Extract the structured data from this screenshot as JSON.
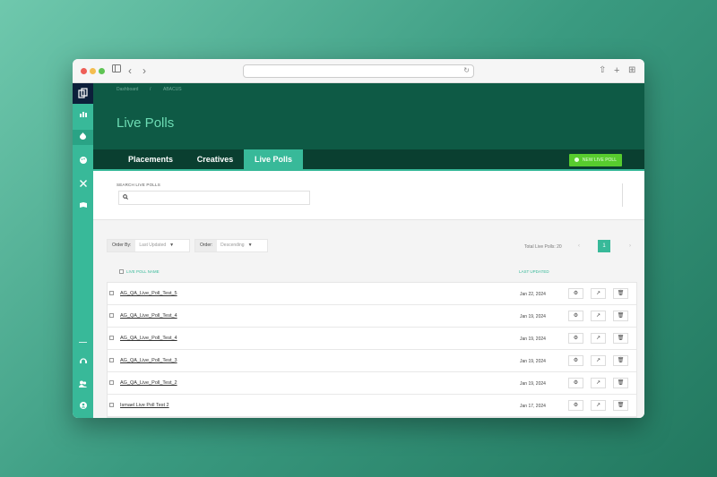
{
  "browser": {
    "back": "‹",
    "forward": "›",
    "sidebar_icon": "sidebar-icon",
    "reload": "↻",
    "share": "⇧",
    "newtab": "+",
    "tabs": "⊞"
  },
  "app": {
    "logo": "▢"
  },
  "sidebar": {
    "items": [
      "dashboard-icon",
      "flame-icon",
      "palette-icon",
      "tools-icon",
      "flag-icon"
    ],
    "bottom": [
      "support-icon",
      "users-icon",
      "account-icon"
    ]
  },
  "breadcrumb": {
    "first": "Dashboard",
    "separator": "/",
    "second": "ABACUS"
  },
  "page": {
    "title": "Live Polls"
  },
  "tabs": [
    {
      "label": "Placements"
    },
    {
      "label": "Creatives"
    },
    {
      "label": "Live Polls"
    }
  ],
  "new_button": {
    "label": "NEW LIVE POLL"
  },
  "search": {
    "label": "SEARCH LIVE POLLS",
    "placeholder": "",
    "value": ""
  },
  "order_by": {
    "label": "Order By:",
    "value": "Last Updated"
  },
  "order": {
    "label": "Order:",
    "value": "Descending"
  },
  "pagination": {
    "total": "Total Live Polls: 20",
    "prev": "‹",
    "current": "1",
    "next": "›"
  },
  "columns": {
    "name": "LIVE POLL NAME",
    "updated": "LAST UPDATED"
  },
  "rows": [
    {
      "name": "AG_QA_Live_Poll_Test_5",
      "date": "Jan 22, 2024"
    },
    {
      "name": "AG_QA_Live_Poll_Test_4",
      "date": "Jan 19, 2024"
    },
    {
      "name": "AG_QA_Live_Poll_Test_4",
      "date": "Jan 19, 2024"
    },
    {
      "name": "AG_QA_Live_Poll_Test_3",
      "date": "Jan 19, 2024"
    },
    {
      "name": "AG_QA_Live_Poll_Test_2",
      "date": "Jan 19, 2024"
    },
    {
      "name": "Ismael Live Poll Test 2",
      "date": "Jan 17, 2024"
    }
  ],
  "colors": {
    "accent": "#38b999",
    "header": "#0e5a45",
    "new_button": "#57cc2e"
  }
}
